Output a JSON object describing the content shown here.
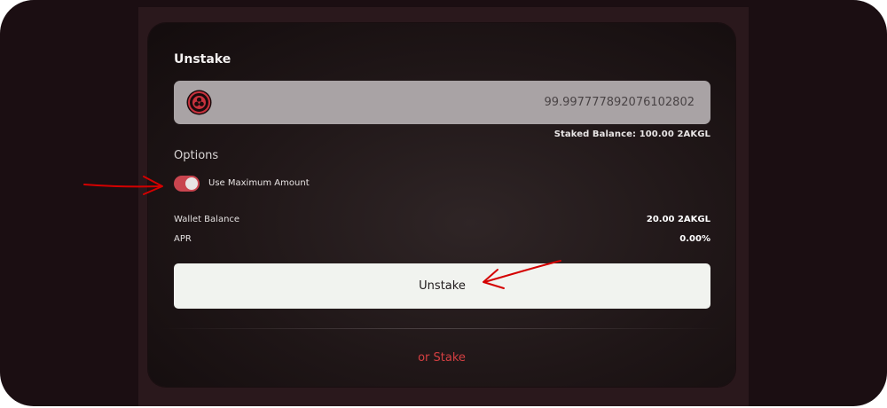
{
  "card": {
    "title": "Unstake"
  },
  "amount": {
    "value": "99.997777892076102802",
    "token_icon": "token-logo-icon"
  },
  "staked_balance": {
    "label": "Staked Balance:",
    "value": "100.00 2AKGL",
    "text": "Staked Balance:  100.00 2AKGL"
  },
  "options": {
    "label": "Options",
    "use_max": {
      "label": "Use Maximum Amount",
      "enabled": true
    }
  },
  "info": {
    "wallet_balance": {
      "label": "Wallet Balance",
      "value": "20.00 2AKGL"
    },
    "apr": {
      "label": "APR",
      "value": "0.00%"
    }
  },
  "actions": {
    "unstake_label": "Unstake",
    "switch_label": "or Stake"
  },
  "colors": {
    "accent": "#c9454f",
    "link": "#d43f42",
    "button": "#f1f3ef",
    "annotation": "#d40000"
  }
}
